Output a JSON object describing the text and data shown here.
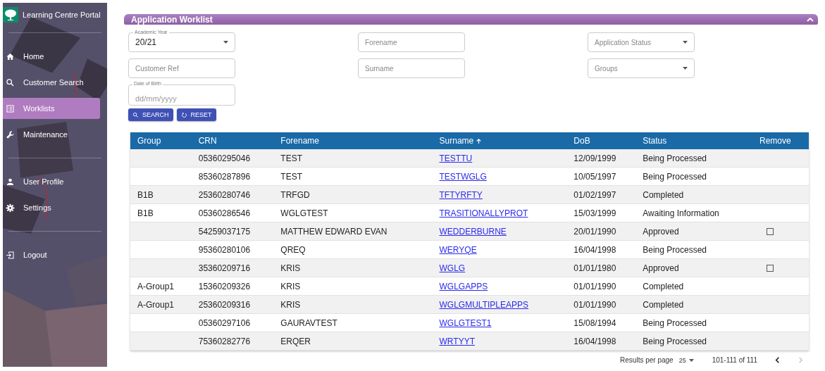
{
  "sidebar": {
    "title": "Learning Centre Portal",
    "groups": [
      [
        {
          "label": "Home",
          "selected": false
        },
        {
          "label": "Customer Search",
          "selected": false
        },
        {
          "label": "Worklists",
          "selected": true
        },
        {
          "label": "Maintenance",
          "selected": false
        }
      ],
      [
        {
          "label": "User Profile",
          "selected": false
        },
        {
          "label": "Settings",
          "selected": false
        }
      ],
      [
        {
          "label": "Logout",
          "selected": false
        }
      ]
    ]
  },
  "panel": {
    "title": "Application Worklist",
    "expanded": true
  },
  "filters": [
    {
      "kind": "select",
      "label": "Academic Year",
      "value": "20/21"
    },
    {
      "kind": "text",
      "placeholder": "Forename"
    },
    {
      "kind": "select",
      "placeholder": "Application Status"
    },
    {
      "kind": "text",
      "placeholder": "Customer Ref"
    },
    {
      "kind": "text",
      "placeholder": "Surname"
    },
    {
      "kind": "select",
      "placeholder": "Groups"
    },
    {
      "kind": "date",
      "label": "Date of Birth",
      "placeholder": "dd/mm/yyyy"
    }
  ],
  "buttons": [
    {
      "label": "SEARCH"
    },
    {
      "label": "RESET"
    }
  ],
  "table": {
    "columns": [
      {
        "label": "Group",
        "sorted": false
      },
      {
        "label": "CRN",
        "sorted": false
      },
      {
        "label": "Forename",
        "sorted": false
      },
      {
        "label": "Surname",
        "sorted": true
      },
      {
        "label": "DoB",
        "sorted": false
      },
      {
        "label": "Status",
        "sorted": false
      },
      {
        "label": "Remove",
        "sorted": false
      }
    ],
    "rows": [
      {
        "group": "",
        "crn": "05360295046",
        "forename": "TEST",
        "surname": "TESTTU",
        "dob": "12/09/1999",
        "status": "Being Processed"
      },
      {
        "group": "",
        "crn": "85360287896",
        "forename": "TEST",
        "surname": "TESTWGLG",
        "dob": "10/05/1997",
        "status": "Being Processed"
      },
      {
        "group": "B1B",
        "crn": "25360280746",
        "forename": "TRFGD",
        "surname": "TFTYRFTY",
        "dob": "01/02/1997",
        "status": "Completed"
      },
      {
        "group": "B1B",
        "crn": "05360286546",
        "forename": "WGLGTEST",
        "surname": "TRASITIONALLYPROT",
        "dob": "15/03/1999",
        "status": "Awaiting Information"
      },
      {
        "group": "",
        "crn": "54259037175",
        "forename": "MATTHEW EDWARD EVAN",
        "surname": "WEDDERBURNE",
        "dob": "20/01/1990",
        "status": "Approved",
        "remove": {
          "checked": false
        }
      },
      {
        "group": "",
        "crn": "95360280106",
        "forename": "QREQ",
        "surname": "WERYQE",
        "dob": "16/04/1998",
        "status": "Being Processed"
      },
      {
        "group": "",
        "crn": "35360209716",
        "forename": "KRIS",
        "surname": "WGLG",
        "dob": "01/01/1980",
        "status": "Approved",
        "remove": {
          "checked": false
        }
      },
      {
        "group": "A-Group1",
        "crn": "15360209326",
        "forename": "KRIS",
        "surname": "WGLGAPPS",
        "dob": "01/01/1990",
        "status": "Completed"
      },
      {
        "group": "A-Group1",
        "crn": "25360209316",
        "forename": "KRIS",
        "surname": "WGLGMULTIPLEAPPS",
        "dob": "01/01/1990",
        "status": "Completed"
      },
      {
        "group": "",
        "crn": "05360297106",
        "forename": "GAURAVTEST",
        "surname": "WGLGTEST1",
        "dob": "15/08/1994",
        "status": "Being Processed"
      },
      {
        "group": "",
        "crn": "75360282776",
        "forename": "ERQER",
        "surname": "WRTYYT",
        "dob": "16/04/1998",
        "status": "Being Processed"
      }
    ]
  },
  "pagination": {
    "label": "Results per page",
    "per_page": "25",
    "range": "101-111 of 111",
    "prev_disabled": false,
    "next_disabled": true
  }
}
